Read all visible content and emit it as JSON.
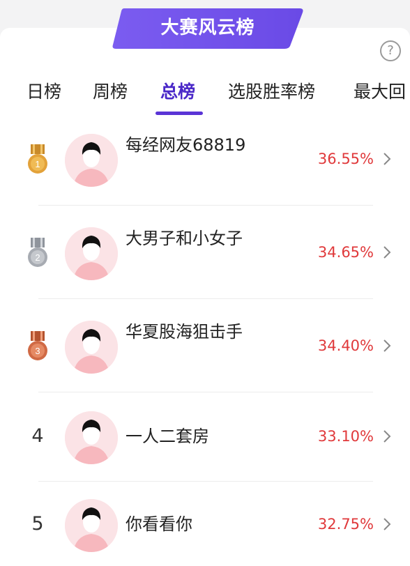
{
  "banner": {
    "title": "大赛风云榜"
  },
  "help": {
    "glyph": "?"
  },
  "tabs": [
    {
      "label": "日榜"
    },
    {
      "label": "周榜"
    },
    {
      "label": "总榜"
    },
    {
      "label": "选股胜率榜"
    },
    {
      "label": "最大回"
    }
  ],
  "active_tab": "总榜",
  "rows": [
    {
      "rank": "1",
      "name": "每经网友68819",
      "rate": "36.55%",
      "medal": "gold"
    },
    {
      "rank": "2",
      "name": "大男子和小女子",
      "rate": "34.65%",
      "medal": "silver"
    },
    {
      "rank": "3",
      "name": "华夏股海狙击手",
      "rate": "34.40%",
      "medal": "bronze"
    },
    {
      "rank": "4",
      "name": "一人二套房",
      "rate": "33.10%"
    },
    {
      "rank": "5",
      "name": "你看看你",
      "rate": "32.75%"
    }
  ],
  "colors": {
    "accent": "#5a34d6",
    "rate": "#e0393b",
    "gold": "#e3a23a",
    "silver": "#a7abb2",
    "bronze": "#d06a45"
  }
}
